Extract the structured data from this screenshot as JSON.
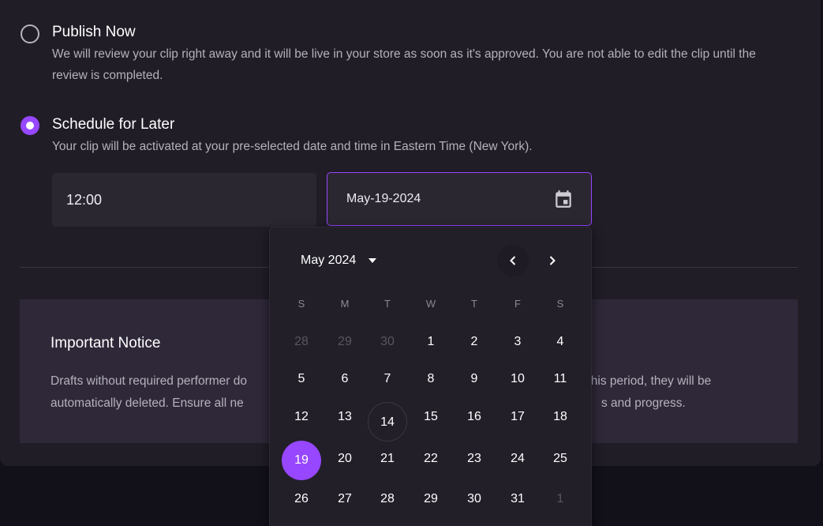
{
  "options": [
    {
      "title": "Publish Now",
      "description": "We will review your clip right away and it will be live in your store as soon as it's approved. You are not able to edit the clip until the review is completed.",
      "selected": false
    },
    {
      "title": "Schedule for Later",
      "description": "Your clip will be activated at your pre-selected date and time in Eastern Time (New York).",
      "selected": true
    }
  ],
  "time_value": "12:00",
  "date_value": "May-19-2024",
  "notice": {
    "title": "Important Notice",
    "text_line1_left": "Drafts without required performer do",
    "text_line1_right": "r this period, they will be",
    "text_line2_left": "automatically deleted. Ensure all ne",
    "text_line2_right": "s and progress."
  },
  "calendar": {
    "month_label": "May 2024",
    "weekdays": [
      "S",
      "M",
      "T",
      "W",
      "T",
      "F",
      "S"
    ],
    "weeks": [
      [
        "28",
        "29",
        "30",
        "1",
        "2",
        "3",
        "4"
      ],
      [
        "5",
        "6",
        "7",
        "8",
        "9",
        "10",
        "11"
      ],
      [
        "12",
        "13",
        "14",
        "15",
        "16",
        "17",
        "18"
      ],
      [
        "19",
        "20",
        "21",
        "22",
        "23",
        "24",
        "25"
      ],
      [
        "26",
        "27",
        "28",
        "29",
        "30",
        "31",
        "1"
      ]
    ],
    "muted_cells": [
      "0-0",
      "0-1",
      "0-2",
      "4-6"
    ],
    "today_cell": "2-2",
    "selected_cell": "3-0"
  },
  "colors": {
    "accent": "#9747ff",
    "panel": "#211d27",
    "notice_bg": "#2f2839"
  }
}
